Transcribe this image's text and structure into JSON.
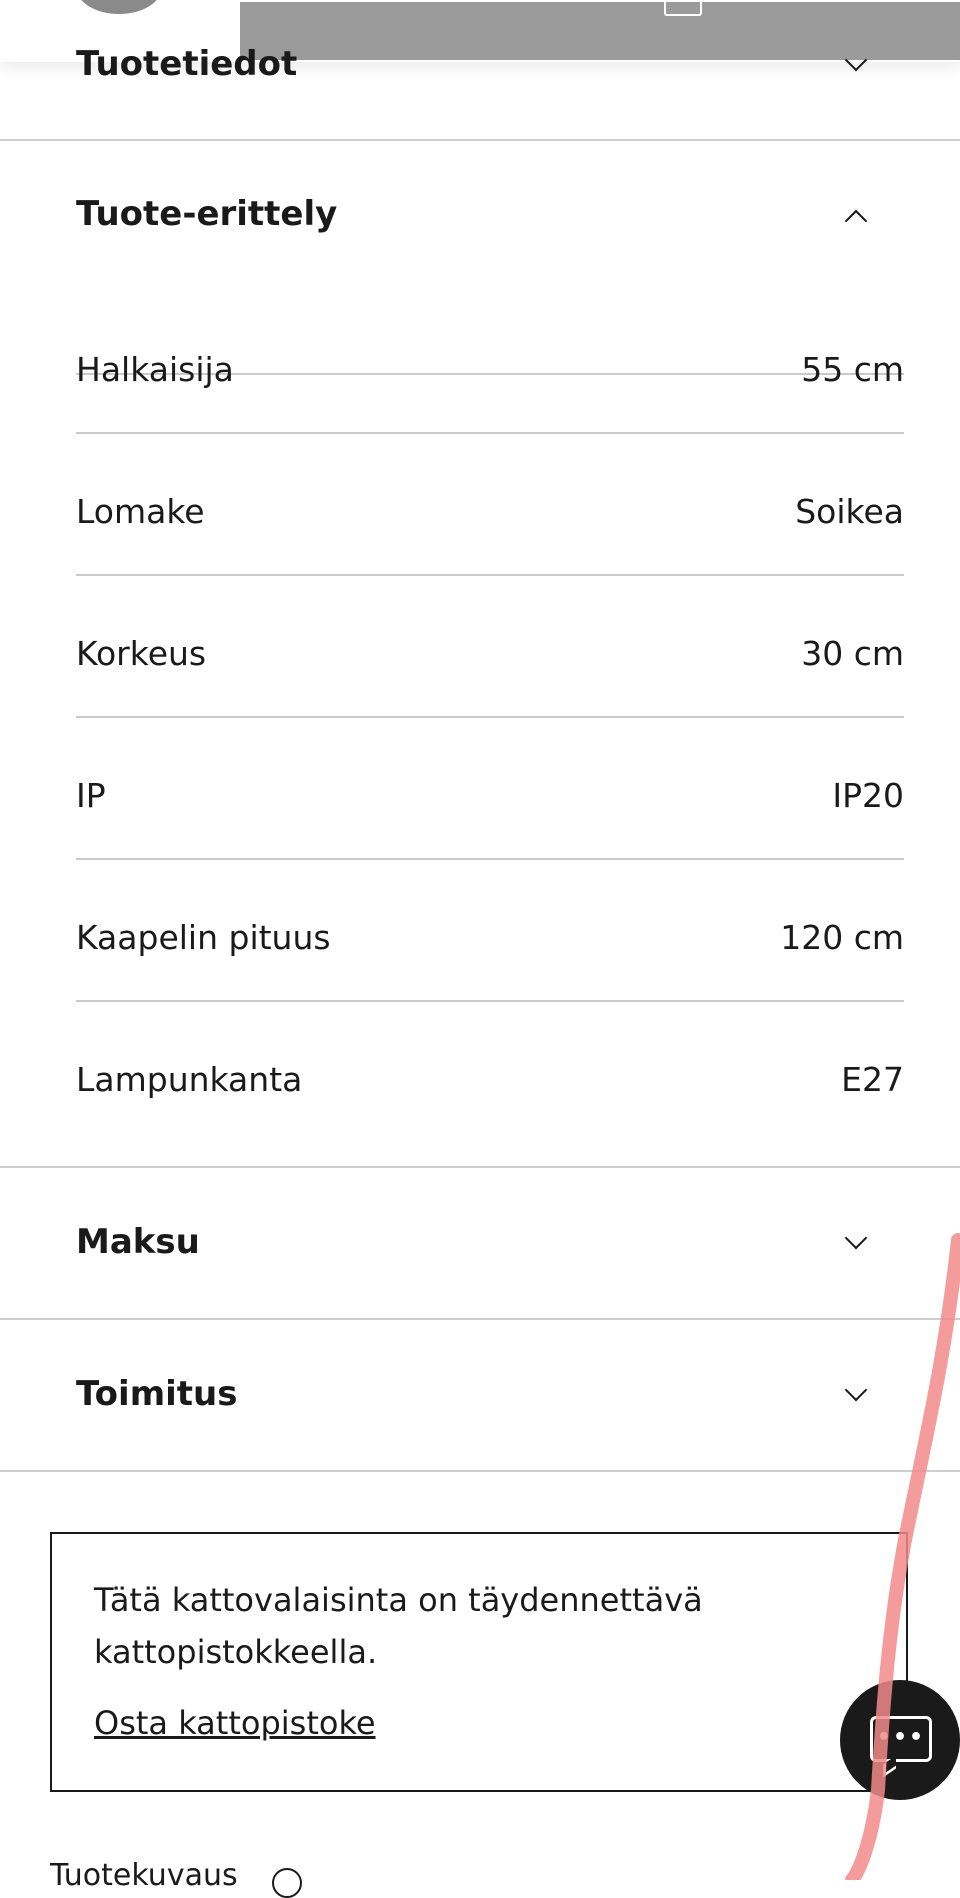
{
  "sections": {
    "product_info": {
      "title": "Tuotetiedot",
      "expanded": false
    },
    "spec": {
      "title": "Tuote-erittely",
      "expanded": true,
      "rows": [
        {
          "label": "Halkaisija",
          "value": "55 cm"
        },
        {
          "label": "Lomake",
          "value": "Soikea"
        },
        {
          "label": "Korkeus",
          "value": "30 cm"
        },
        {
          "label": "IP",
          "value": "IP20"
        },
        {
          "label": "Kaapelin pituus",
          "value": "120 cm"
        },
        {
          "label": "Lampunkanta",
          "value": "E27"
        }
      ]
    },
    "payment": {
      "title": "Maksu",
      "expanded": false
    },
    "delivery": {
      "title": "Toimitus",
      "expanded": false
    }
  },
  "info_box": {
    "text": "Tätä kattovalaisinta on täydennettävä kattopistokkeella.",
    "link": "Osta kattopistoke"
  },
  "bottom": {
    "label": "Tuotekuvaus"
  },
  "icons": {
    "chevron": "chevron-icon",
    "chat": "chat-icon",
    "info": "info-icon",
    "bag": "bag-icon"
  },
  "colors": {
    "text": "#1a1a1a",
    "divider": "#cfcfcf",
    "sticky_block": "#9b9b9b",
    "chat_button": "#1a1a1a",
    "annotation_stroke": "#f28b8b"
  }
}
